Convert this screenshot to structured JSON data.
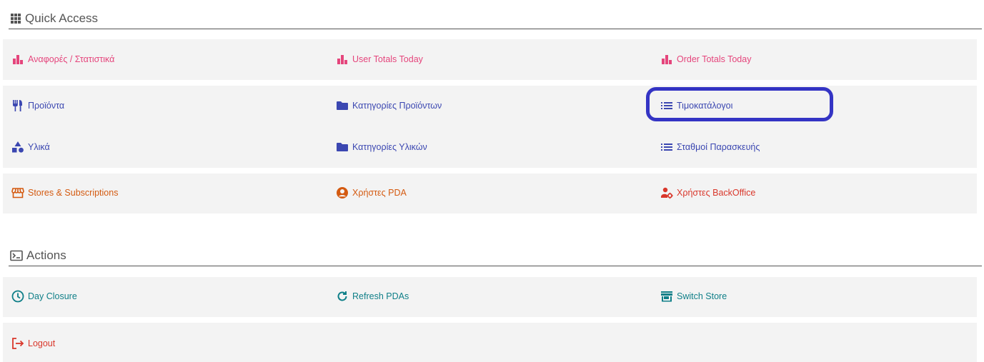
{
  "quick_access": {
    "title": "Quick Access",
    "icon": "grid-icon",
    "reports": {
      "items": [
        {
          "label": "Αναφορές / Στατιστικά",
          "icon": "bar-chart-icon"
        },
        {
          "label": "User Totals Today",
          "icon": "bar-chart-icon"
        },
        {
          "label": "Order Totals Today",
          "icon": "bar-chart-icon"
        }
      ]
    },
    "catalog": {
      "row1": [
        {
          "label": "Προϊόντα",
          "icon": "cutlery-icon"
        },
        {
          "label": "Κατηγορίες Προϊόντων",
          "icon": "folder-icon"
        },
        {
          "label": "Τιμοκατάλογοι",
          "icon": "list-icon"
        }
      ],
      "row2": [
        {
          "label": "Υλικά",
          "icon": "shapes-icon"
        },
        {
          "label": "Κατηγορίες Υλικών",
          "icon": "folder-icon"
        },
        {
          "label": "Σταθμοί Παρασκευής",
          "icon": "list-icon"
        }
      ]
    },
    "admin": {
      "items": [
        {
          "label": "Stores & Subscriptions",
          "icon": "storefront-icon"
        },
        {
          "label": "Χρήστες PDA",
          "icon": "user-circle-icon"
        },
        {
          "label": "Χρήστες BackOffice",
          "icon": "user-cog-icon"
        }
      ]
    }
  },
  "actions": {
    "title": "Actions",
    "icon": "terminal-icon",
    "row1": [
      {
        "label": "Day Closure",
        "icon": "clock-icon"
      },
      {
        "label": "Refresh PDAs",
        "icon": "refresh-icon"
      },
      {
        "label": "Switch Store",
        "icon": "store-icon"
      }
    ],
    "row2": [
      {
        "label": "Logout",
        "icon": "logout-icon"
      }
    ]
  },
  "colors": {
    "reports": "#e5457c",
    "catalog": "#3b47b1",
    "admin_orange": "#d45a10",
    "admin_red": "#d9372b",
    "actions": "#0f7f88",
    "logout": "#d9372b",
    "highlight": "#3434c4"
  }
}
